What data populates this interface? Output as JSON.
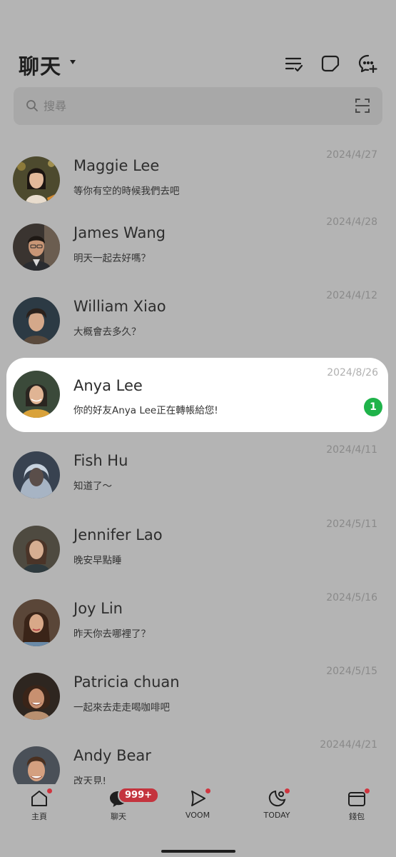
{
  "header": {
    "title": "聊天",
    "icons": [
      "checklist-icon",
      "new-note-icon",
      "add-chat-icon"
    ]
  },
  "search": {
    "placeholder": "搜尋"
  },
  "chats": [
    {
      "name": "Maggie Lee",
      "preview": "等你有空的時候我們去吧",
      "date": "2024/4/27",
      "avatar": "avatar-maggie-lee"
    },
    {
      "name": "James Wang",
      "preview": "明天一起去好嗎？",
      "date": "2024/4/28",
      "avatar": "avatar-james-wang"
    },
    {
      "name": "William Xiao",
      "preview": "大概會去多久？",
      "date": "2024/4/12",
      "avatar": "avatar-william-xiao"
    },
    {
      "name": "Anya Lee",
      "preview": "你的好友Anya Lee正在轉帳給您!",
      "date": "2024/8/26",
      "unread": "1",
      "avatar": "avatar-anya-lee"
    },
    {
      "name": "Fish Hu",
      "preview": "知道了～",
      "date": "2024/4/11",
      "avatar": "avatar-fish-hu"
    },
    {
      "name": "Jennifer Lao",
      "preview": "晚安早點睡",
      "date": "2024/5/11",
      "avatar": "avatar-jennifer-lao"
    },
    {
      "name": "Joy Lin",
      "preview": "昨天你去哪裡了？",
      "date": "2024/5/16",
      "avatar": "avatar-joy-lin"
    },
    {
      "name": "Patricia chuan",
      "preview": "一起來去走走喝咖啡吧",
      "date": "2024/5/15",
      "avatar": "avatar-patricia-chuan"
    },
    {
      "name": "Andy Bear",
      "preview": "改天見!",
      "date": "20244/4/21",
      "avatar": "avatar-andy-bear"
    }
  ],
  "tabs": [
    {
      "label": "主頁",
      "icon": "home-icon"
    },
    {
      "label": "聊天",
      "icon": "chat-icon",
      "badge": "999+"
    },
    {
      "label": "VOOM",
      "icon": "voom-icon"
    },
    {
      "label": "TODAY",
      "icon": "today-icon"
    },
    {
      "label": "錢包",
      "icon": "wallet-icon"
    }
  ],
  "colors": {
    "background": "#b4b4b4",
    "unread_badge": "#1fb34a",
    "notification_badge": "#c4343e"
  }
}
